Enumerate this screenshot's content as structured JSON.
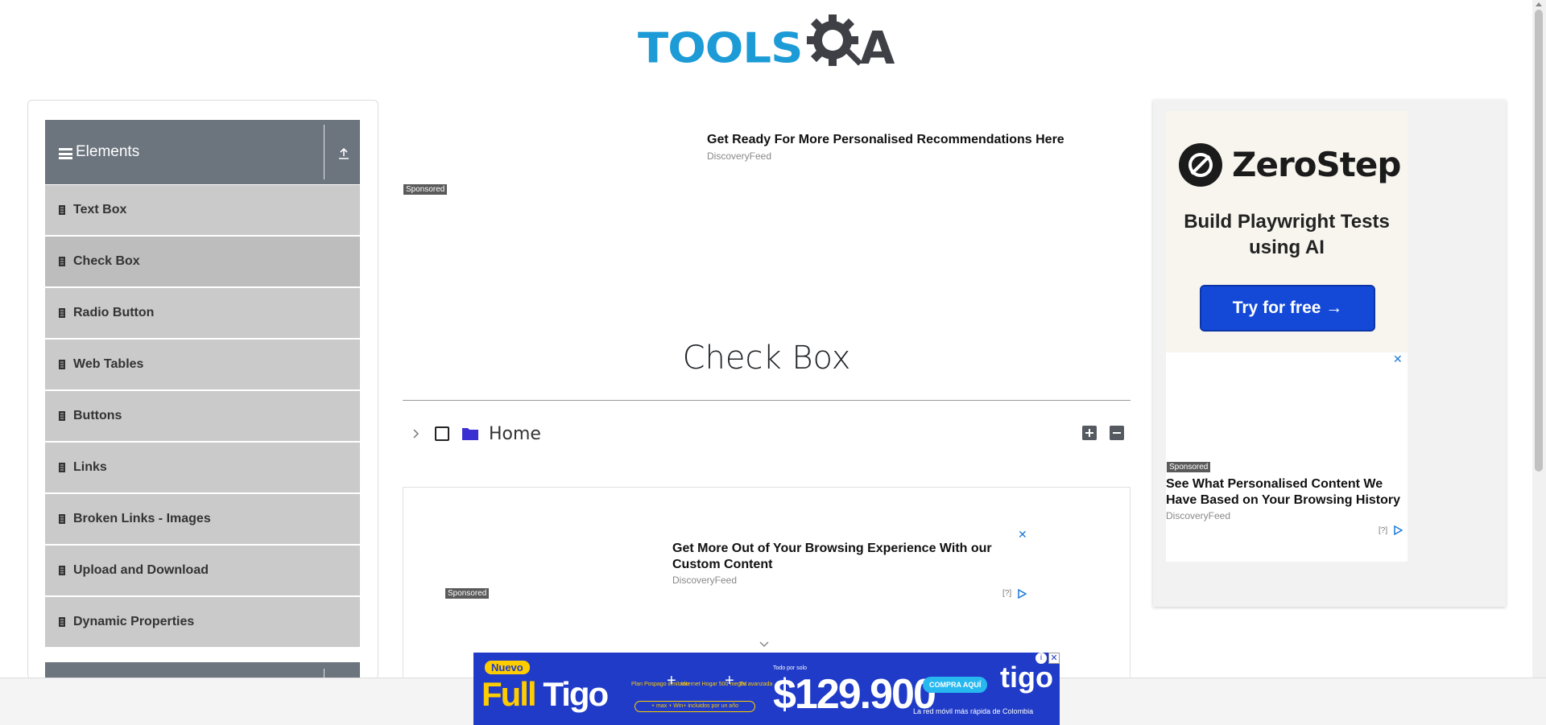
{
  "header": {
    "logo_text_tools": "TOOLS",
    "logo_text_a": "A",
    "logo_colors": {
      "tools": "#1d9bd6",
      "qa": "#3f3f46"
    }
  },
  "sidebar": {
    "group_title": "Elements",
    "items": [
      {
        "label": "Text Box"
      },
      {
        "label": "Check Box",
        "active": true
      },
      {
        "label": "Radio Button"
      },
      {
        "label": "Web Tables"
      },
      {
        "label": "Buttons"
      },
      {
        "label": "Links"
      },
      {
        "label": "Broken Links - Images"
      },
      {
        "label": "Upload and Download"
      },
      {
        "label": "Dynamic Properties"
      }
    ]
  },
  "ad_top": {
    "headline": "Get Ready For More Personalised Recommendations Here",
    "source": "DiscoveryFeed",
    "sponsored": "Sponsored"
  },
  "main": {
    "title": "Check Box",
    "tree": {
      "root_label": "Home",
      "checked": false,
      "expanded": false
    }
  },
  "ad_mid": {
    "headline": "Get More Out of Your Browsing Experience With our Custom Content",
    "source": "DiscoveryFeed",
    "sponsored": "Sponsored",
    "adchoices": "[?]"
  },
  "ad_right": {
    "brand": "ZeroStep",
    "subtitle": "Build Playwright Tests using AI",
    "cta": "Try for free →",
    "sponsored": "Sponsored",
    "headline": "See What Personalised Content We Have Based on Your Browsing History",
    "source": "DiscoveryFeed",
    "adchoices": "[?]",
    "colors": {
      "cta": "#1449d8"
    }
  },
  "banner": {
    "nuevo": "Nuevo",
    "full": "Full",
    "tigo": "Tigo",
    "plus": "+",
    "feature_1": "Plan Pospago ilimitado",
    "feature_2": "Internet Hogar 500 megas",
    "feature_3": "TV avanzada",
    "included": "+ max + Win+ incluidos por un año",
    "price_pre": "Todo por solo",
    "price": "$129.900",
    "cta": "COMPRA AQUÍ",
    "brand": "tigo",
    "tagline": "La red móvil más rápida de Colombia",
    "close": "✕",
    "info": "i",
    "colors": {
      "bg": "#1f3bc7",
      "accent": "#ffcc00"
    }
  }
}
